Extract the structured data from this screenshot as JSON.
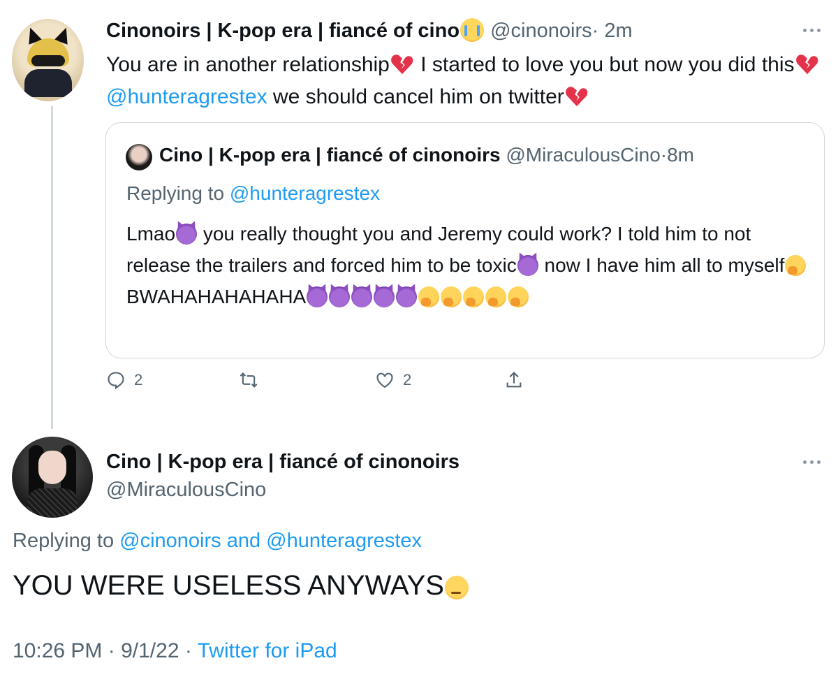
{
  "tweet1": {
    "display_name": "Cinonoirs | K-pop era | fiancé of cino",
    "handle": "@cinonoirs",
    "sep": "·",
    "time": "2m",
    "text_part1": "You are in another relationship",
    "text_part2": " I started to love you but now you did this",
    "mention": "@hunteragrestex",
    "text_part3": " we should cancel him on twitter",
    "reply_count": "2",
    "like_count": "2"
  },
  "quoted": {
    "display_name": "Cino | K-pop era | fiancé of cinonoirs",
    "handle": "@MiraculousCino",
    "sep": "·",
    "time": "8m",
    "replying_label": "Replying to ",
    "replying_to": "@hunteragrestex",
    "text_part1": "Lmao",
    "text_part2": " you really thought you and Jeremy could work? I told him to not release the trailers and forced him to be toxic",
    "text_part3": " now I have him all to myself",
    "text_part4": " BWAHAHAHAHAHA"
  },
  "tweet2": {
    "display_name": "Cino | K-pop era | fiancé of cinonoirs",
    "handle": "@MiraculousCino",
    "replying_label": "Replying to ",
    "replying_to_1": "@cinonoirs",
    "and": " and ",
    "replying_to_2": "@hunteragrestex",
    "text": "YOU WERE USELESS ANYWAYS",
    "time": "10:26 PM",
    "sep": " · ",
    "date": "9/1/22",
    "source": "Twitter for iPad"
  },
  "icons": {
    "reply": "reply-icon",
    "retweet": "retweet-icon",
    "like": "heart-icon",
    "share": "share-icon",
    "more": "more-icon"
  },
  "colors": {
    "link": "#1d9bf0",
    "secondary": "#536471",
    "border": "#cfd9de"
  }
}
